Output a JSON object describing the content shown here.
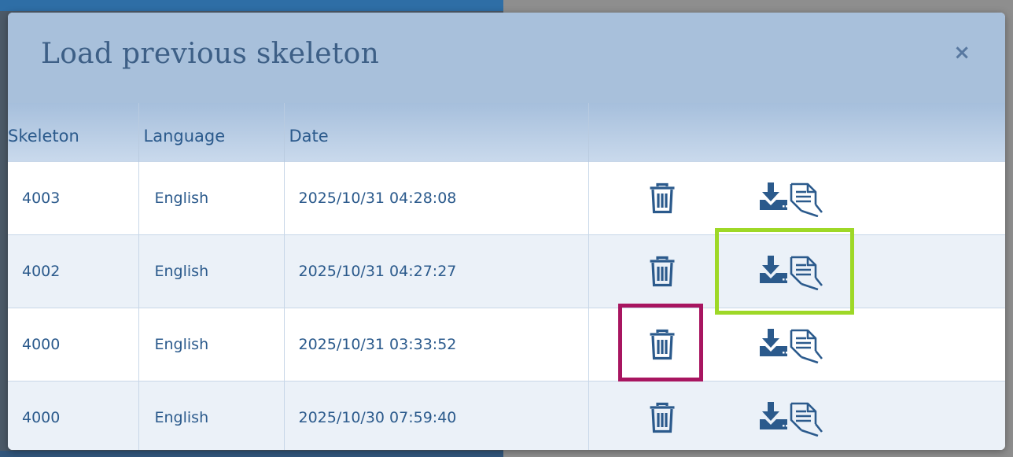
{
  "dialog": {
    "title": "Load previous skeleton",
    "close_label": "×"
  },
  "table": {
    "columns": [
      "Skeleton",
      "Language",
      "Date",
      ""
    ],
    "rows": [
      {
        "skeleton": "4003",
        "language": "English",
        "date": "2025/10/31 04:28:08"
      },
      {
        "skeleton": "4002",
        "language": "English",
        "date": "2025/10/31 04:27:27"
      },
      {
        "skeleton": "4000",
        "language": "English",
        "date": "2025/10/31 03:33:52"
      },
      {
        "skeleton": "4000",
        "language": "English",
        "date": "2025/10/30 07:59:40"
      }
    ]
  },
  "icons": {
    "delete": "trash-icon",
    "load": "download-document-icon"
  },
  "colors": {
    "header_bg": "#a8c0db",
    "text": "#2b5a8c",
    "icon": "#2b5a8c",
    "highlight_green": "#9ed827",
    "highlight_red": "#a81560"
  }
}
